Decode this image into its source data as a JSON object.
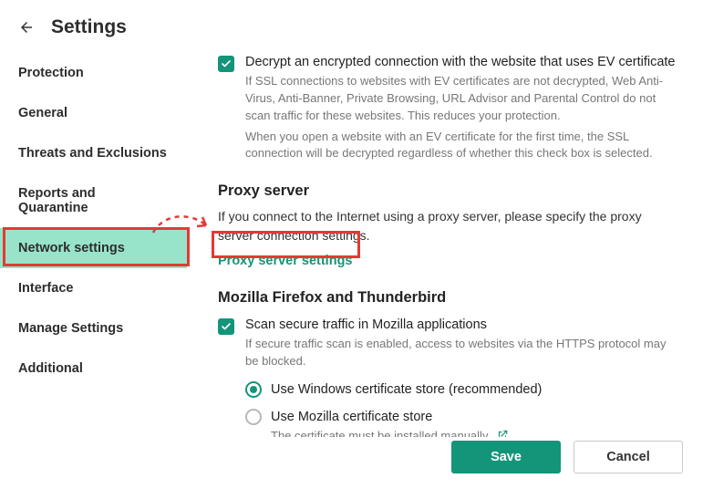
{
  "header": {
    "title": "Settings"
  },
  "sidebar": {
    "items": [
      {
        "label": "Protection"
      },
      {
        "label": "General"
      },
      {
        "label": "Threats and Exclusions"
      },
      {
        "label": "Reports and Quarantine"
      },
      {
        "label": "Network settings"
      },
      {
        "label": "Interface"
      },
      {
        "label": "Manage Settings"
      },
      {
        "label": "Additional"
      }
    ]
  },
  "main": {
    "ev": {
      "label": "Decrypt an encrypted connection with the website that uses EV certificate",
      "desc1": "If SSL connections to websites with EV certificates are not decrypted, Web Anti-Virus, Anti-Banner, Private Browsing, URL Advisor and Parental Control do not scan traffic for these websites. This reduces your protection.",
      "desc2": "When you open a website with an EV certificate for the first time, the SSL connection will be decrypted regardless of whether this check box is selected."
    },
    "proxy": {
      "title": "Proxy server",
      "intro": "If you connect to the Internet using a proxy server, please specify the proxy server connection settings.",
      "link": "Proxy server settings"
    },
    "firefox": {
      "title": "Mozilla Firefox and Thunderbird",
      "scan_label": "Scan secure traffic in Mozilla applications",
      "scan_desc": "If secure traffic scan is enabled, access to websites via the HTTPS protocol may be blocked.",
      "radio_windows": "Use Windows certificate store (recommended)",
      "radio_mozilla": "Use Mozilla certificate store",
      "mozilla_note": "The certificate must be installed manually."
    }
  },
  "footer": {
    "save": "Save",
    "cancel": "Cancel"
  }
}
